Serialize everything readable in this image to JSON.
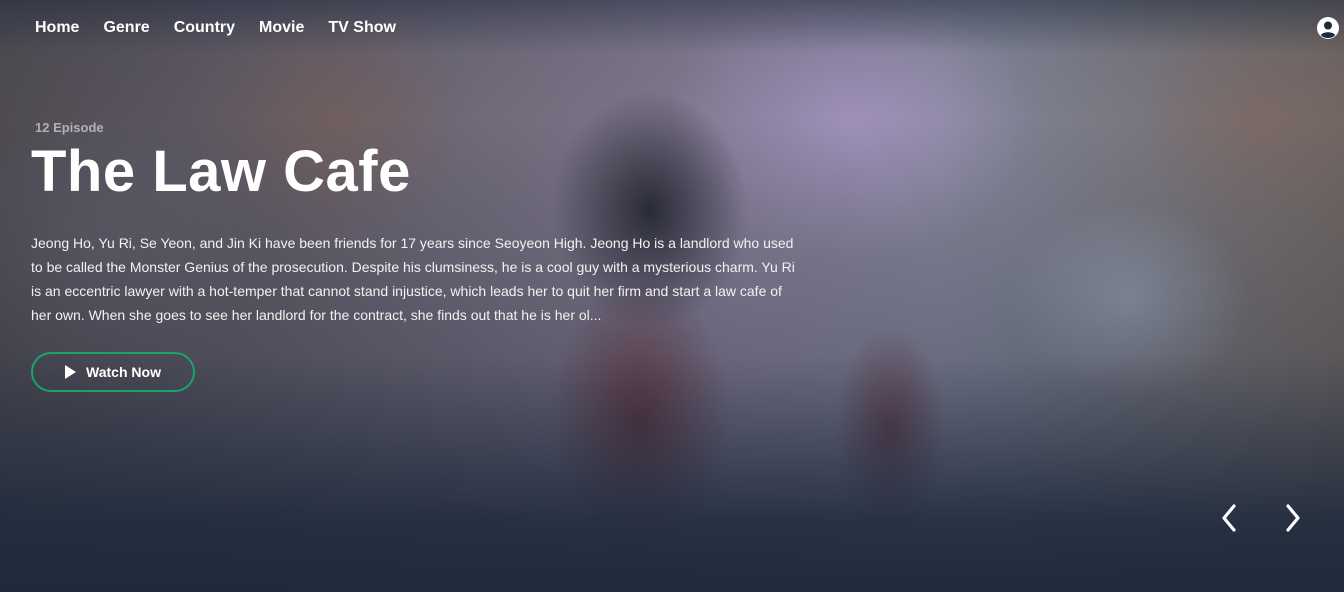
{
  "nav": {
    "items": [
      {
        "label": "Home"
      },
      {
        "label": "Genre"
      },
      {
        "label": "Country"
      },
      {
        "label": "Movie"
      },
      {
        "label": "TV Show"
      }
    ],
    "account_icon": "user-circle-icon"
  },
  "hero": {
    "episode": "12 Episode",
    "title": "The Law Cafe",
    "description": "Jeong Ho, Yu Ri, Se Yeon, and Jin Ki have been friends for 17 years since Seoyeon High. Jeong Ho is a landlord who used to be called the Monster Genius of the prosecution. Despite his clumsiness, he is a cool guy with a mysterious charm. Yu Ri is an eccentric lawyer with a hot-temper that cannot stand injustice, which leads her to quit her firm and start a law cafe of her own. When she goes to see her landlord for the contract, she finds out that he is her ol...",
    "watch_label": "Watch Now",
    "watch_icon": "play-icon"
  },
  "carousel": {
    "prev_icon": "chevron-left-icon",
    "next_icon": "chevron-right-icon"
  },
  "colors": {
    "accent": "#1aa36b",
    "background": "#1f2a3c"
  }
}
